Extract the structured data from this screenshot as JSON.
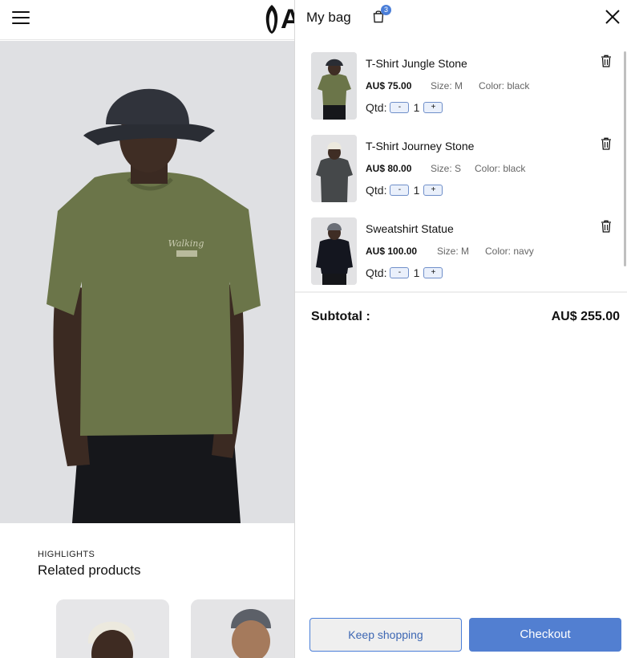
{
  "header": {
    "logo_letter": "A",
    "menu_icon": "hamburger-menu-icon"
  },
  "highlights": {
    "kicker": "HIGHLIGHTS",
    "title": "Related products"
  },
  "bag": {
    "title": "My bag",
    "count": "3",
    "close_icon": "close-icon",
    "items": [
      {
        "name": "T-Shirt Jungle Stone",
        "price": "AU$ 75.00",
        "size": "Size: M",
        "color": "Color: black",
        "qty_label": "Qtd:",
        "qty": "1",
        "minus": "-",
        "plus": "+"
      },
      {
        "name": "T-Shirt Journey Stone",
        "price": "AU$ 80.00",
        "size": "Size: S",
        "color": "Color: black",
        "qty_label": "Qtd:",
        "qty": "1",
        "minus": "-",
        "plus": "+"
      },
      {
        "name": "Sweatshirt Statue",
        "price": "AU$ 100.00",
        "size": "Size: M",
        "color": "Color: navy",
        "qty_label": "Qtd:",
        "qty": "1",
        "minus": "-",
        "plus": "+"
      }
    ],
    "subtotal_label": "Subtotal :",
    "subtotal_value": "AU$ 255.00",
    "keep_shopping": "Keep shopping",
    "checkout": "Checkout"
  },
  "colors": {
    "accent": "#527fd1",
    "badge": "#4a7ed8"
  }
}
